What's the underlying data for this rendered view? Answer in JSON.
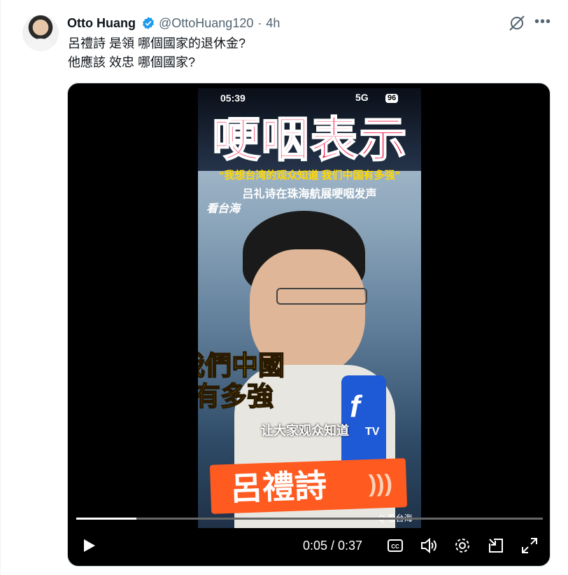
{
  "tweet": {
    "author_name": "Otto Huang",
    "apple_glyph": "",
    "handle": "@OttoHuang120",
    "separator": "·",
    "time": "4h",
    "more_glyph": "•••",
    "text_lines": [
      "呂禮詩 是領 哪個國家的退休金?",
      "他應該 效忠 哪個國家?"
    ]
  },
  "video": {
    "statusbar_time": "05:39",
    "statusbar_signal": "5G",
    "statusbar_battery": "96",
    "headline": "哽咽表示",
    "quote": "“我想台湾的观众知道 我们中国有多强”",
    "subtitle": "吕礼诗在珠海航展哽咽发声",
    "logo": "看台海",
    "caption_line1": "我們中國",
    "caption_line2": "有多強",
    "caption_sub": "让大家观众知道",
    "mic_glyph": "f",
    "mic_label": "TV",
    "name_banner": "呂禮詩",
    "watermark": "Q 看台海",
    "current_time": "0:05",
    "duration": "0:37",
    "time_readout": "0:05 / 0:37",
    "progress_fraction": 0.129
  },
  "colors": {
    "verified": "#1d9bf0",
    "headline": "#f2164a",
    "caption": "#ffe000",
    "banner": "#ff5a1f"
  },
  "icons": [
    "apple-icon",
    "verified-icon",
    "grok-icon",
    "more-icon",
    "play-icon",
    "captions-icon",
    "volume-icon",
    "settings-icon",
    "pip-icon",
    "fullscreen-icon"
  ]
}
